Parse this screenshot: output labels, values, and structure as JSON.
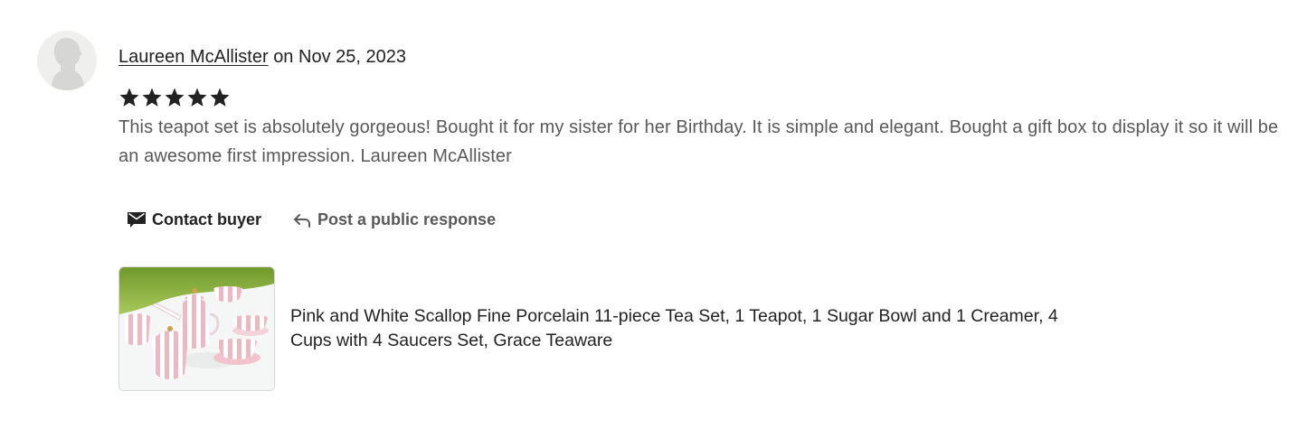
{
  "reviewer": {
    "name": "Laureen McAllister",
    "date_prefix": "on",
    "date": "Nov 25, 2023"
  },
  "rating": {
    "stars": 5,
    "max": 5
  },
  "review": {
    "text": "This teapot set is absolutely gorgeous! Bought it for my sister for her Birthday. It is simple and elegant. Bought a gift box to display it so it will be an awesome first impression. Laureen McAllister"
  },
  "actions": {
    "contact_label": "Contact buyer",
    "respond_label": "Post a public response"
  },
  "product": {
    "title": "Pink and White Scallop Fine Porcelain 11-piece Tea Set, 1 Teapot, 1 Sugar Bowl and 1 Creamer, 4 Cups with 4 Saucers Set, Grace Teaware"
  },
  "colors": {
    "text_primary": "#222222",
    "text_secondary": "#595959",
    "star": "#222222",
    "avatar_bg": "#efefed"
  },
  "icons": {
    "avatar": "person-silhouette-icon",
    "star": "star-icon",
    "contact": "envelope-icon",
    "respond": "reply-arrow-icon"
  }
}
